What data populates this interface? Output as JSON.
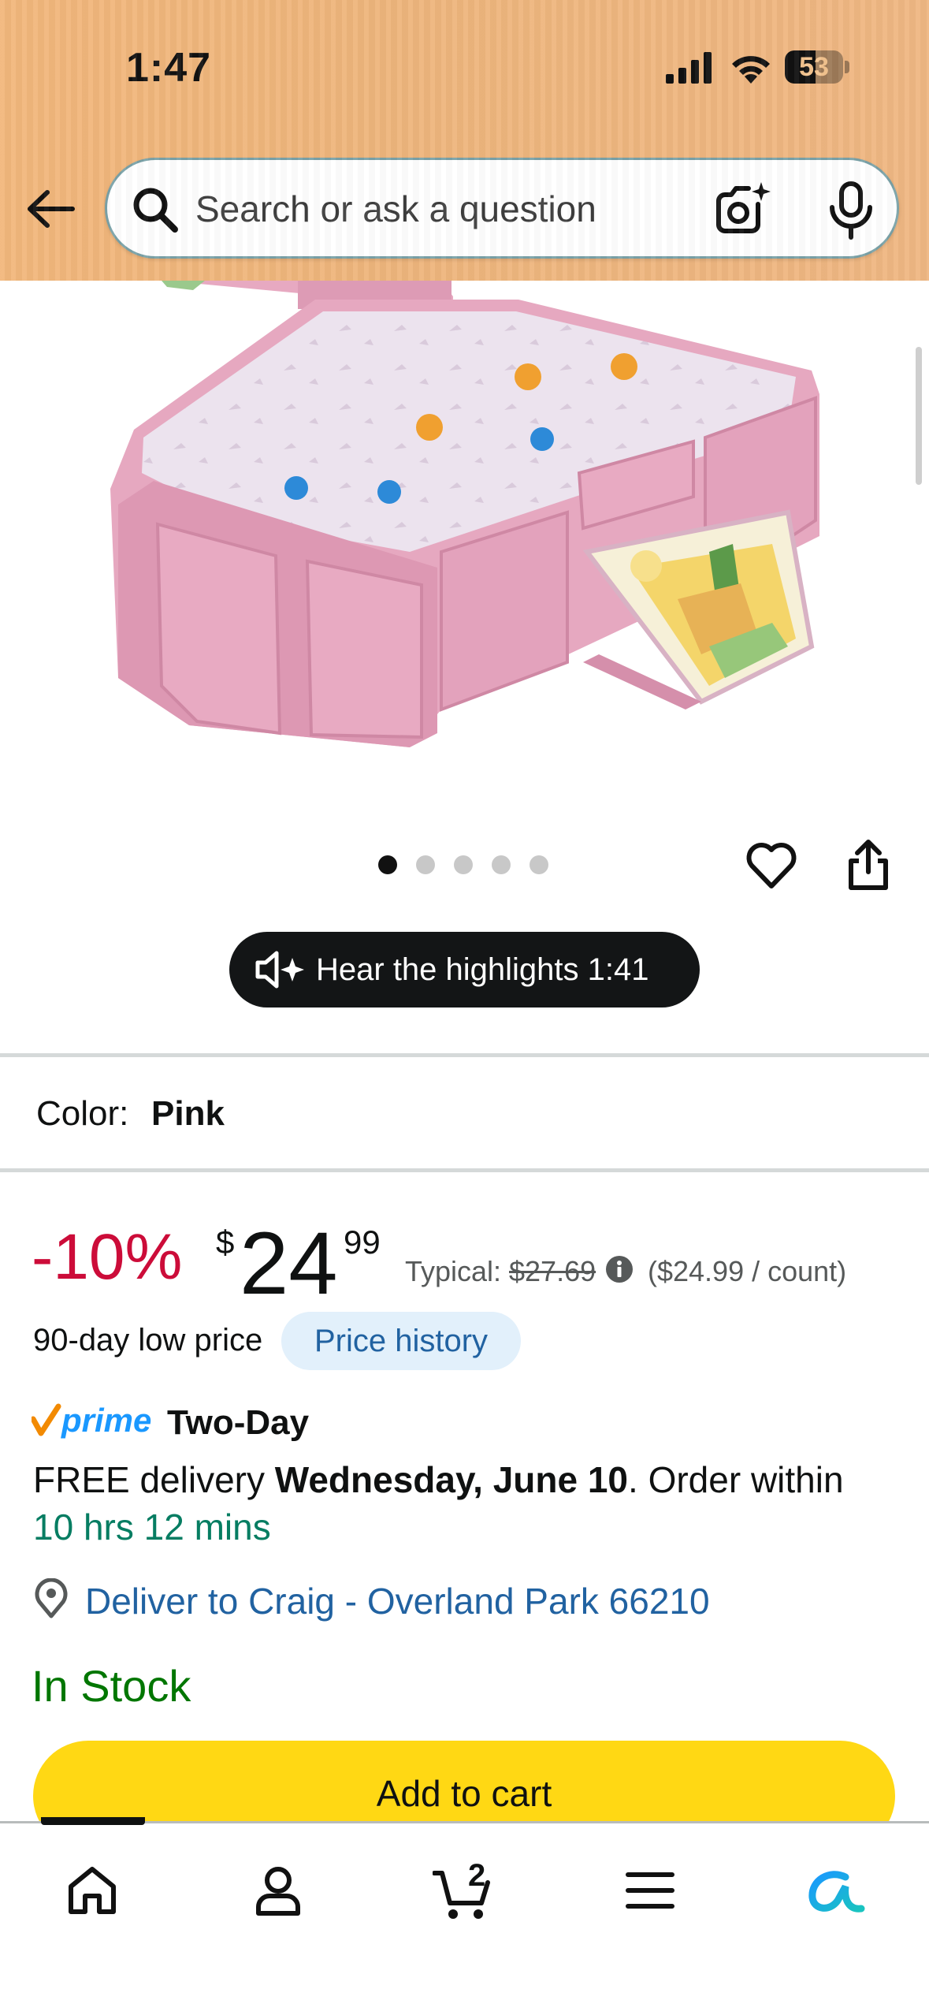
{
  "status_bar": {
    "time": "1:47",
    "battery_level": "53",
    "battery_fraction": 0.53
  },
  "header": {
    "search_placeholder": "Search or ask a question",
    "back_icon": "arrow-left-icon",
    "search_icon": "search-icon",
    "lens_icon": "camera-lens-icon",
    "mic_icon": "microphone-icon"
  },
  "gallery": {
    "image_count": 5,
    "active_index": 0,
    "actions": [
      "heart-icon",
      "share-icon"
    ]
  },
  "highlights": {
    "label": "Hear the highlights 1:41",
    "icon": "speaker-sparkle-icon"
  },
  "product": {
    "color_label": "Color:",
    "color_value": "Pink"
  },
  "pricing": {
    "discount": "-10%",
    "currency_symbol": "$",
    "price_whole": "24",
    "price_fraction": "99",
    "typical_label": "Typical:",
    "typical_price": "$27.69",
    "unit_price": "($24.99 / count)",
    "low_price_label": "90-day low price",
    "price_history_label": "Price history"
  },
  "delivery": {
    "prime_word": "prime",
    "prime_label": "Two-Day",
    "delivery_prefix": "FREE delivery ",
    "delivery_date": "Wednesday, June 10",
    "delivery_suffix": ". Order within",
    "countdown": "10 hrs 12 mins",
    "deliver_to": "Deliver to Craig - Overland Park 66210"
  },
  "availability": {
    "stock": "In Stock"
  },
  "actions": {
    "add_to_cart": "Add to cart"
  },
  "bottom_nav": {
    "cart_count": "2",
    "items": [
      "home-icon",
      "account-icon",
      "cart-icon",
      "menu-icon",
      "rufus-ai-icon"
    ]
  },
  "colors": {
    "header_bg": "#efb67e",
    "discount": "#cc0c39",
    "link": "#2162a1",
    "in_stock": "#007600",
    "countdown": "#067d62",
    "cart_button": "#ffd814",
    "price_history_bg": "#e2f0fb"
  }
}
